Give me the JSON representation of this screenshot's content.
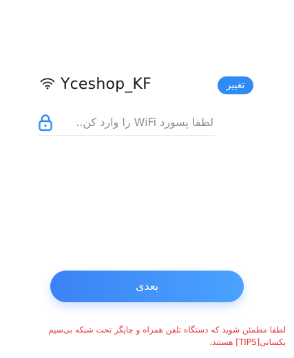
{
  "wifi": {
    "icon": "wifi-icon",
    "ssid": "Yceshop_KF",
    "change_label": "تغییر"
  },
  "password": {
    "icon": "lock-icon",
    "placeholder": "لطفا پسورد WiFi را وارد کن..",
    "value": ""
  },
  "next_label": "بعدی",
  "tips_text": "لطفا مطمئن شوید که دستگاه تلفن همراه و چایگر تحت شبکه بی‌سیم یکسانی[TIPS] هستند.",
  "colors": {
    "accent": "#2f8cf5",
    "button_gradient_start": "#3c82f6",
    "button_gradient_end": "#4aa3ff",
    "tips": "#e53935"
  }
}
